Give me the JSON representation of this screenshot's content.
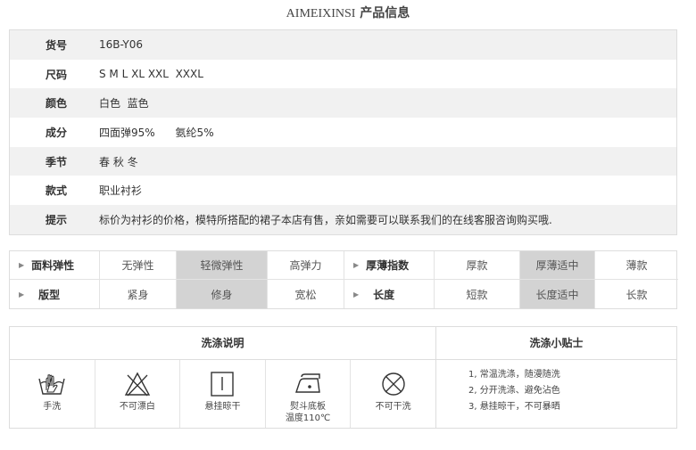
{
  "title": {
    "brand": "AIMEIXINSI",
    "suffix": " 产品信息"
  },
  "info": [
    {
      "key": "货号",
      "value": "16B-Y06"
    },
    {
      "key": "尺码",
      "value": "S M L XL XXL  XXXL"
    },
    {
      "key": "颜色",
      "value": "白色  蓝色"
    },
    {
      "key": "成分",
      "value": "四面弹95%      氨纶5%"
    },
    {
      "key": "季节",
      "value": "春 秋 冬"
    },
    {
      "key": "款式",
      "value": "职业衬衫"
    },
    {
      "key": "提示",
      "value": "标价为衬衫的价格，模特所搭配的裙子本店有售，亲如需要可以联系我们的在线客服咨询购买哦."
    }
  ],
  "elastic": {
    "row1": {
      "label1": "面料弹性",
      "opts1": [
        "无弹性",
        "轻微弹性",
        "高弹力"
      ],
      "selected1": 1,
      "label2": "厚薄指数",
      "opts2": [
        "厚款",
        "厚薄适中",
        "薄款"
      ],
      "selected2": 1
    },
    "row2": {
      "label1": "版型",
      "opts1": [
        "紧身",
        "修身",
        "宽松"
      ],
      "selected1": 1,
      "label2": "长度",
      "opts2": [
        "短款",
        "长度适中",
        "长款"
      ],
      "selected2": 1
    }
  },
  "wash": {
    "left_title": "洗涤说明",
    "right_title": "洗涤小贴士",
    "icons": [
      {
        "icon": "hand-wash-icon",
        "caption": "手洗"
      },
      {
        "icon": "no-bleach-icon",
        "caption": "不可漂白"
      },
      {
        "icon": "hang-dry-icon",
        "caption": "悬挂晾干"
      },
      {
        "icon": "iron-icon",
        "caption": "熨斗底板\n温度110℃"
      },
      {
        "icon": "no-dry-clean-icon",
        "caption": "不可干洗"
      }
    ],
    "tips": [
      "1, 常温洗涤，随漫随洗",
      "2, 分开洗涤、避免沾色",
      "3, 悬挂晾干，不可暴晒"
    ]
  }
}
